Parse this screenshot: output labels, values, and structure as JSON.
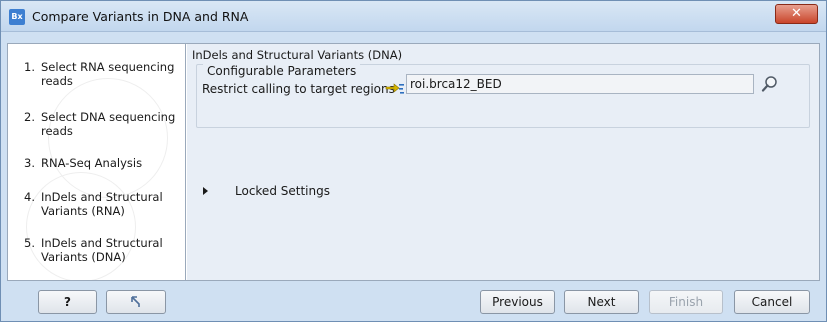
{
  "window": {
    "title": "Compare Variants in DNA and RNA",
    "icon_text": "Bx",
    "close_symbol": "✕"
  },
  "steps": [
    {
      "num": "1.",
      "label": "Select RNA sequencing reads"
    },
    {
      "num": "2.",
      "label": "Select DNA sequencing reads"
    },
    {
      "num": "3.",
      "label": "RNA-Seq Analysis"
    },
    {
      "num": "4.",
      "label": "InDels and Structural Variants (RNA)"
    },
    {
      "num": "5.",
      "label": "InDels and Structural Variants (DNA)"
    }
  ],
  "content": {
    "section_title": "InDels and Structural Variants (DNA)",
    "group_title": "Configurable Parameters",
    "param_label": "Restrict calling to target regions",
    "param_value": "roi.brca12_BED",
    "locked_label": "Locked Settings"
  },
  "buttons": {
    "help": "?",
    "previous": "Previous",
    "next": "Next",
    "finish": "Finish",
    "cancel": "Cancel"
  },
  "icons": {
    "app": "app-icon",
    "close": "close-icon",
    "target_region": "target-region-icon",
    "browse": "browse-icon",
    "reset": "reset-arrow-icon",
    "expand": "expand-triangle-icon"
  }
}
